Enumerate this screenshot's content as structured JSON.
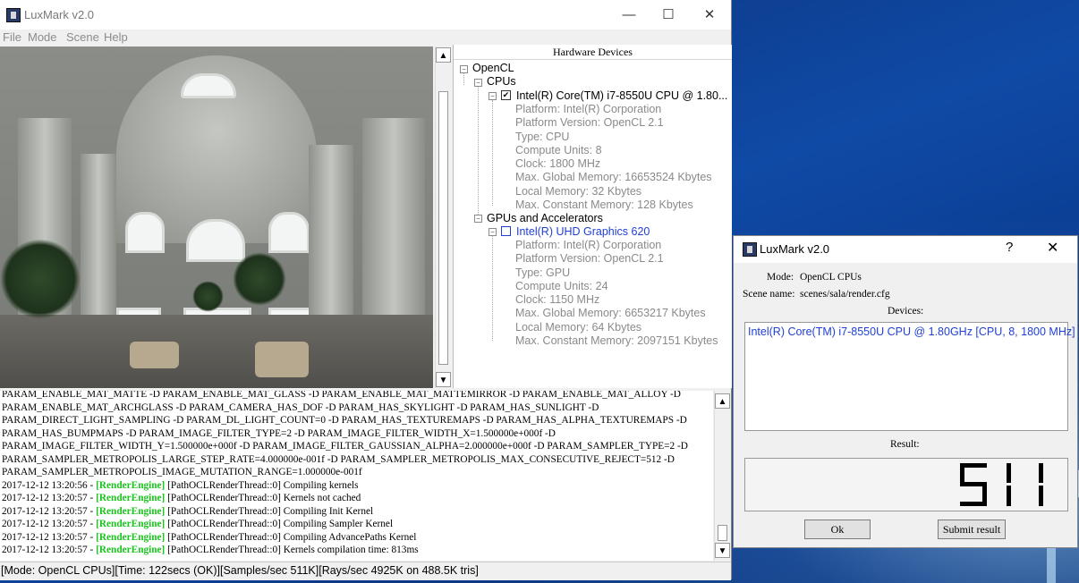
{
  "main_window": {
    "title": "LuxMark v2.0",
    "controls": {
      "minimize": "—",
      "maximize": "☐",
      "close": "✕"
    },
    "menu": [
      "File",
      "Mode",
      "Scene",
      "Help"
    ]
  },
  "hardware": {
    "header": "Hardware Devices",
    "platform": "OpenCL",
    "cpus_label": "CPUs",
    "cpu_device": {
      "name": "Intel(R) Core(TM) i7-8550U CPU @ 1.80...",
      "checked": true,
      "props": [
        "Platform: Intel(R) Corporation",
        "Platform Version: OpenCL 2.1",
        "Type: CPU",
        "Compute Units: 8",
        "Clock: 1800 MHz",
        "Max. Global Memory: 16653524 Kbytes",
        "Local Memory: 32 Kbytes",
        "Max. Constant Memory: 128 Kbytes"
      ]
    },
    "gpus_label": "GPUs and Accelerators",
    "gpu_device": {
      "name": "Intel(R) UHD Graphics 620",
      "checked": false,
      "props": [
        "Platform: Intel(R) Corporation",
        "Platform Version: OpenCL 2.1",
        "Type: GPU",
        "Compute Units: 24",
        "Clock: 1150 MHz",
        "Max. Global Memory: 6653217 Kbytes",
        "Local Memory: 64 Kbytes",
        "Max. Constant Memory: 2097151 Kbytes"
      ]
    }
  },
  "log": {
    "param_lines": [
      "PARAM_ENABLE_MAT_MATTE -D PARAM_ENABLE_MAT_GLASS -D PARAM_ENABLE_MAT_MATTEMIRROR -D PARAM_ENABLE_MAT_ALLOY -D",
      "PARAM_ENABLE_MAT_ARCHGLASS -D PARAM_CAMERA_HAS_DOF -D PARAM_HAS_SKYLIGHT -D PARAM_HAS_SUNLIGHT -D",
      "PARAM_DIRECT_LIGHT_SAMPLING -D PARAM_DL_LIGHT_COUNT=0 -D PARAM_HAS_TEXTUREMAPS -D PARAM_HAS_ALPHA_TEXTUREMAPS -D",
      "PARAM_HAS_BUMPMAPS -D PARAM_IMAGE_FILTER_TYPE=2 -D PARAM_IMAGE_FILTER_WIDTH_X=1.500000e+000f -D",
      "PARAM_IMAGE_FILTER_WIDTH_Y=1.500000e+000f -D PARAM_IMAGE_FILTER_GAUSSIAN_ALPHA=2.000000e+000f -D PARAM_SAMPLER_TYPE=2 -D",
      "PARAM_SAMPLER_METROPOLIS_LARGE_STEP_RATE=4.000000e-001f -D PARAM_SAMPLER_METROPOLIS_MAX_CONSECUTIVE_REJECT=512 -D",
      "PARAM_SAMPLER_METROPOLIS_IMAGE_MUTATION_RANGE=1.000000e-001f"
    ],
    "entries": [
      {
        "ts": "2017-12-12 13:20:56 -",
        "tag": "[RenderEngine]",
        "msg": "[PathOCLRenderThread::0] Compiling kernels"
      },
      {
        "ts": "2017-12-12 13:20:57 -",
        "tag": "[RenderEngine]",
        "msg": "[PathOCLRenderThread::0] Kernels not cached"
      },
      {
        "ts": "2017-12-12 13:20:57 -",
        "tag": "[RenderEngine]",
        "msg": "[PathOCLRenderThread::0] Compiling Init Kernel"
      },
      {
        "ts": "2017-12-12 13:20:57 -",
        "tag": "[RenderEngine]",
        "msg": "[PathOCLRenderThread::0] Compiling Sampler Kernel"
      },
      {
        "ts": "2017-12-12 13:20:57 -",
        "tag": "[RenderEngine]",
        "msg": "[PathOCLRenderThread::0] Compiling AdvancePaths Kernel"
      },
      {
        "ts": "2017-12-12 13:20:57 -",
        "tag": "[RenderEngine]",
        "msg": "[PathOCLRenderThread::0] Kernels compilation time: 813ms"
      }
    ]
  },
  "status": "[Mode: OpenCL CPUs][Time: 122secs (OK)][Samples/sec    511K][Rays/sec   4925K on 488.5K tris]",
  "dialog": {
    "title": "LuxMark v2.0",
    "help": "?",
    "close": "✕",
    "mode_label": "Mode:",
    "mode_value": "OpenCL CPUs",
    "scene_label": "Scene name:",
    "scene_value": "scenes/sala/render.cfg",
    "devices_label": "Devices:",
    "device": "Intel(R) Core(TM) i7-8550U CPU @ 1.80GHz [CPU, 8, 1800 MHz]",
    "result_label": "Result:",
    "result": "511",
    "ok": "Ok",
    "submit": "Submit result"
  },
  "colors": {
    "log_tag": "#19c41c",
    "device_blue": "#1f3fd6",
    "prop_grey": "#8a8a8a"
  }
}
